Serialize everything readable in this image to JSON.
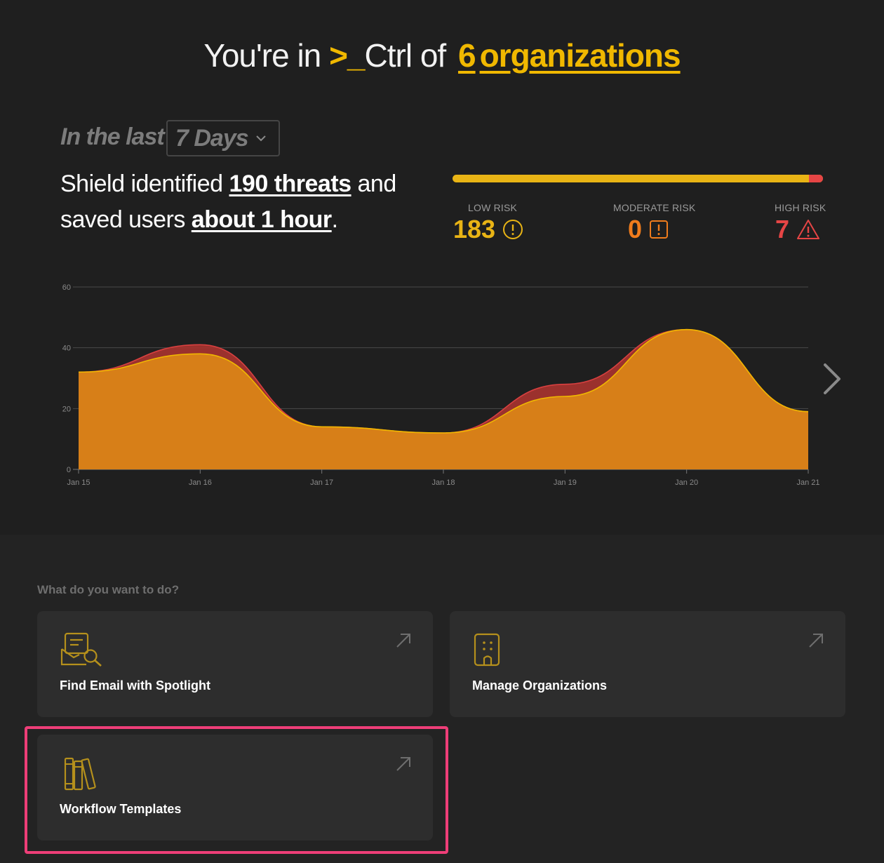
{
  "header": {
    "prefix": "You're in",
    "prompt": ">_",
    "brand": "Ctrl of",
    "org_count": "6",
    "org_label": "organizations"
  },
  "filter": {
    "prefix": "In the last",
    "range": "7 Days"
  },
  "summary": {
    "part1": "Shield identified",
    "threats": "190 threats",
    "part2": "and saved users",
    "saved": "about 1 hour",
    "end": "."
  },
  "risk": {
    "low_pct": 0.963,
    "moderate_pct": 0.0,
    "high_pct": 0.037,
    "low": {
      "label": "LOW RISK",
      "value": "183",
      "color": "#e9b415",
      "icon": "alert-circle-icon"
    },
    "moderate": {
      "label": "MODERATE RISK",
      "value": "0",
      "color": "#f07c1c",
      "icon": "alert-square-icon"
    },
    "high": {
      "label": "HIGH RISK",
      "value": "7",
      "color": "#e64545",
      "icon": "alert-triangle-icon"
    }
  },
  "chart_data": {
    "type": "area",
    "x": [
      "Jan 15",
      "Jan 16",
      "Jan 17",
      "Jan 18",
      "Jan 19",
      "Jan 20",
      "Jan 21"
    ],
    "ylim": [
      0,
      60
    ],
    "yticks": [
      "0",
      "20",
      "40",
      "60"
    ],
    "grid": true,
    "series": [
      {
        "values": [
          32,
          41,
          14,
          12,
          28,
          46,
          19
        ],
        "color": "#a8332f"
      },
      {
        "values": [
          32,
          38,
          14,
          12,
          24,
          46,
          19
        ],
        "color": "#d98218"
      }
    ]
  },
  "actions": {
    "question": "What do you want to do?",
    "cards": [
      {
        "title": "Find Email with Spotlight",
        "icon": "email-search-icon"
      },
      {
        "title": "Manage Organizations",
        "icon": "building-icon"
      },
      {
        "title": "Workflow Templates",
        "icon": "books-icon"
      }
    ]
  }
}
